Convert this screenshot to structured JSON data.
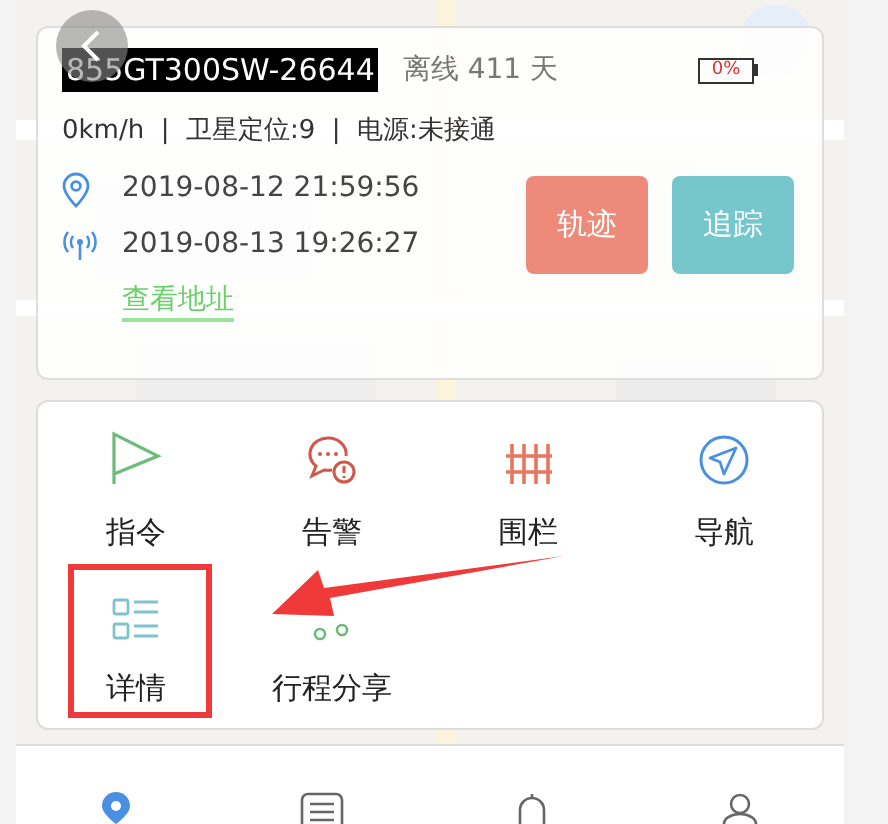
{
  "device": {
    "id": "855GT300SW-26644",
    "status": "离线 411 天",
    "battery": "0%",
    "stats": "0km/h  |  卫星定位:9  |  电源:未接通",
    "times": [
      {
        "kind": "location",
        "text": "2019-08-12 21:59:56"
      },
      {
        "kind": "signal",
        "text": "2019-08-13 19:26:27"
      }
    ],
    "address_link": "查看地址"
  },
  "buttons": [
    {
      "kind": "track",
      "label": "轨迹"
    },
    {
      "kind": "follow",
      "label": "追踪"
    }
  ],
  "actions": [
    {
      "kind": "flag",
      "label": "指令"
    },
    {
      "kind": "alert",
      "label": "告警"
    },
    {
      "kind": "fence",
      "label": "围栏"
    },
    {
      "kind": "navigate",
      "label": "导航"
    },
    {
      "kind": "details",
      "label": "详情"
    },
    {
      "kind": "share",
      "label": "行程分享"
    }
  ],
  "tabbar": [
    {
      "kind": "pin",
      "selected": true
    },
    {
      "kind": "list",
      "selected": false
    },
    {
      "kind": "bell",
      "selected": false
    },
    {
      "kind": "user",
      "selected": false
    }
  ]
}
